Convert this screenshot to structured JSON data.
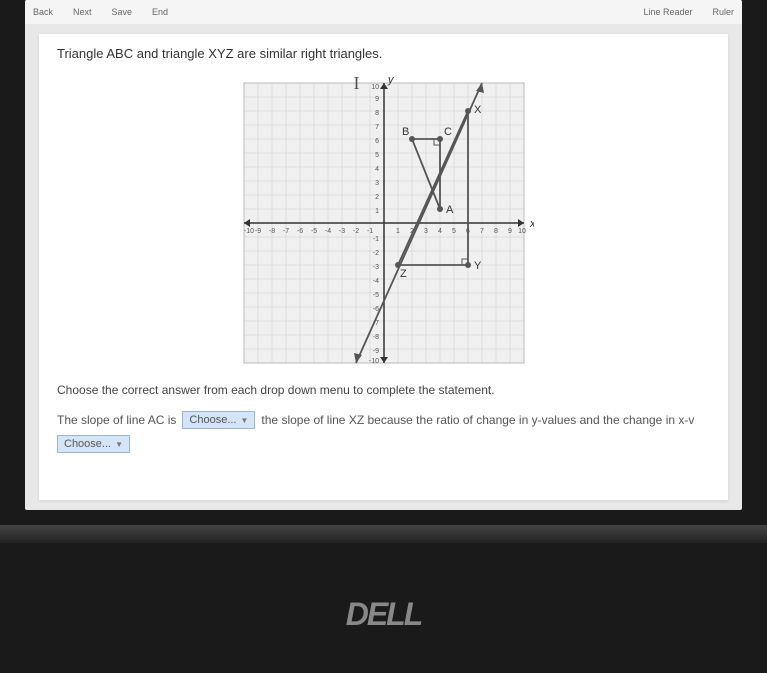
{
  "toolbar": {
    "back": "Back",
    "next": "Next",
    "save": "Save",
    "end": "End",
    "lineReader": "Line Reader",
    "ruler": "Ruler"
  },
  "question": "Triangle ABC and triangle XYZ are similar right triangles.",
  "annotation_I": "I",
  "instruction": "Choose the correct answer from each drop down menu to complete the statement.",
  "answer": {
    "part1": "The slope of line AC is",
    "dropdown1": "Choose...",
    "part2": "the slope of line XZ because the ratio of change in y-values and the change in x-v",
    "dropdown2": "Choose..."
  },
  "logo": "DELL",
  "chart_data": {
    "type": "scatter",
    "title": "",
    "xlabel": "x",
    "ylabel": "y",
    "xlim": [
      -10,
      10
    ],
    "ylim": [
      -10,
      10
    ],
    "x_ticks": [
      -10,
      -9,
      -8,
      -7,
      -6,
      -5,
      -4,
      -3,
      -2,
      -1,
      1,
      2,
      3,
      4,
      5,
      6,
      7,
      8,
      9,
      10
    ],
    "y_ticks": [
      -10,
      -9,
      -8,
      -7,
      -6,
      -5,
      -4,
      -3,
      -2,
      -1,
      1,
      2,
      3,
      4,
      5,
      6,
      7,
      8,
      9,
      10
    ],
    "points": {
      "A": {
        "x": 4,
        "y": 1
      },
      "B": {
        "x": 2,
        "y": 6
      },
      "C": {
        "x": 4,
        "y": 6
      },
      "X": {
        "x": 6,
        "y": 8
      },
      "Y": {
        "x": 6,
        "y": -3
      },
      "Z": {
        "x": 1,
        "y": -3
      }
    },
    "triangles": [
      {
        "name": "ABC",
        "vertices": [
          "A",
          "B",
          "C"
        ],
        "right_angle_at": "C"
      },
      {
        "name": "XYZ",
        "vertices": [
          "X",
          "Y",
          "Z"
        ],
        "right_angle_at": "Y"
      }
    ],
    "line_through": [
      {
        "x": -2,
        "y": -10
      },
      {
        "x": 7,
        "y": 10
      }
    ]
  }
}
